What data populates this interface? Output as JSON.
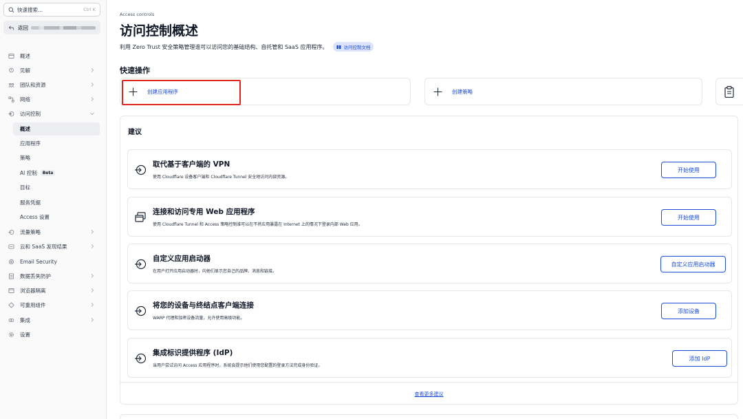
{
  "sidebar": {
    "search": {
      "label": "快速搜索...",
      "shortcut": "Ctrl K"
    },
    "back": {
      "label": "返回"
    },
    "items": [
      {
        "label": "概述",
        "icon": "calendar-icon"
      },
      {
        "label": "见解",
        "icon": "lightbulb-icon"
      },
      {
        "label": "团队和资源",
        "icon": "team-icon"
      },
      {
        "label": "网络",
        "icon": "network-icon"
      },
      {
        "label": "访问控制",
        "icon": "access-icon"
      },
      {
        "label": "流量策略",
        "icon": "traffic-icon"
      },
      {
        "label": "云和 SaaS 发现结果",
        "icon": "cloud-icon"
      },
      {
        "label": "Email Security",
        "icon": "email-icon"
      },
      {
        "label": "数据丢失防护",
        "icon": "dlp-icon"
      },
      {
        "label": "浏览器隔离",
        "icon": "browser-icon"
      },
      {
        "label": "可重用组件",
        "icon": "component-icon"
      },
      {
        "label": "集成",
        "icon": "integration-icon"
      },
      {
        "label": "设置",
        "icon": "gear-icon"
      }
    ],
    "sub_items": [
      {
        "label": "概述"
      },
      {
        "label": "应用程序"
      },
      {
        "label": "策略"
      },
      {
        "label": "AI 控制",
        "badge": "Beta"
      },
      {
        "label": "目标"
      },
      {
        "label": "服务凭据"
      },
      {
        "label": "Access 设置"
      }
    ]
  },
  "header": {
    "breadcrumb": "Access controls",
    "title": "访问控制概述",
    "subtitle": "利用 Zero Trust 安全策略管理谁可以访问您的基础结构、自托管和 SaaS 应用程序。",
    "doc_link": "访问控制文档"
  },
  "quick_actions": {
    "title": "快速操作",
    "items": [
      {
        "label": "创建应用程序"
      },
      {
        "label": "创建策略"
      }
    ]
  },
  "suggestions": {
    "title": "建议",
    "items": [
      {
        "title": "取代基于客户端的 VPN",
        "desc": "使用 Cloudflare 设备客户端和 Cloudflare Tunnel 安全地访问内部资源。",
        "button": "开始使用",
        "icon": "vpn-icon"
      },
      {
        "title": "连接和访问专用 Web 应用程序",
        "desc": "使用 Cloudflare Tunnel 和 Access 策略控制谁可以在不将应用暴露在 Internet 上的情况下登录内部 Web 应用。",
        "button": "开始使用",
        "icon": "web-app-icon"
      },
      {
        "title": "自定义应用启动器",
        "desc": "在用户打开应用启动器时，向他们显示您自己的品牌、消息和链接。",
        "button": "自定义应用启动器",
        "icon": "launcher-icon"
      },
      {
        "title": "将您的设备与终结点客户端连接",
        "desc": "WARP 代理和加密设备流量，允许使用高级功能。",
        "button": "添加设备",
        "icon": "device-icon"
      },
      {
        "title": "集成标识提供程序 (IdP)",
        "desc": "当用户尝试访问 Access 应用程序时，系统会提示他们使用您配置的登录方法完成身份验证。",
        "button": "添加 IdP",
        "icon": "idp-icon"
      }
    ],
    "more_link": "查看更多建议"
  },
  "colors": {
    "accent": "#1d4ed8",
    "highlight": "#e0251b",
    "sidebar_bg": "#fafafa",
    "border": "#e5e7eb"
  }
}
